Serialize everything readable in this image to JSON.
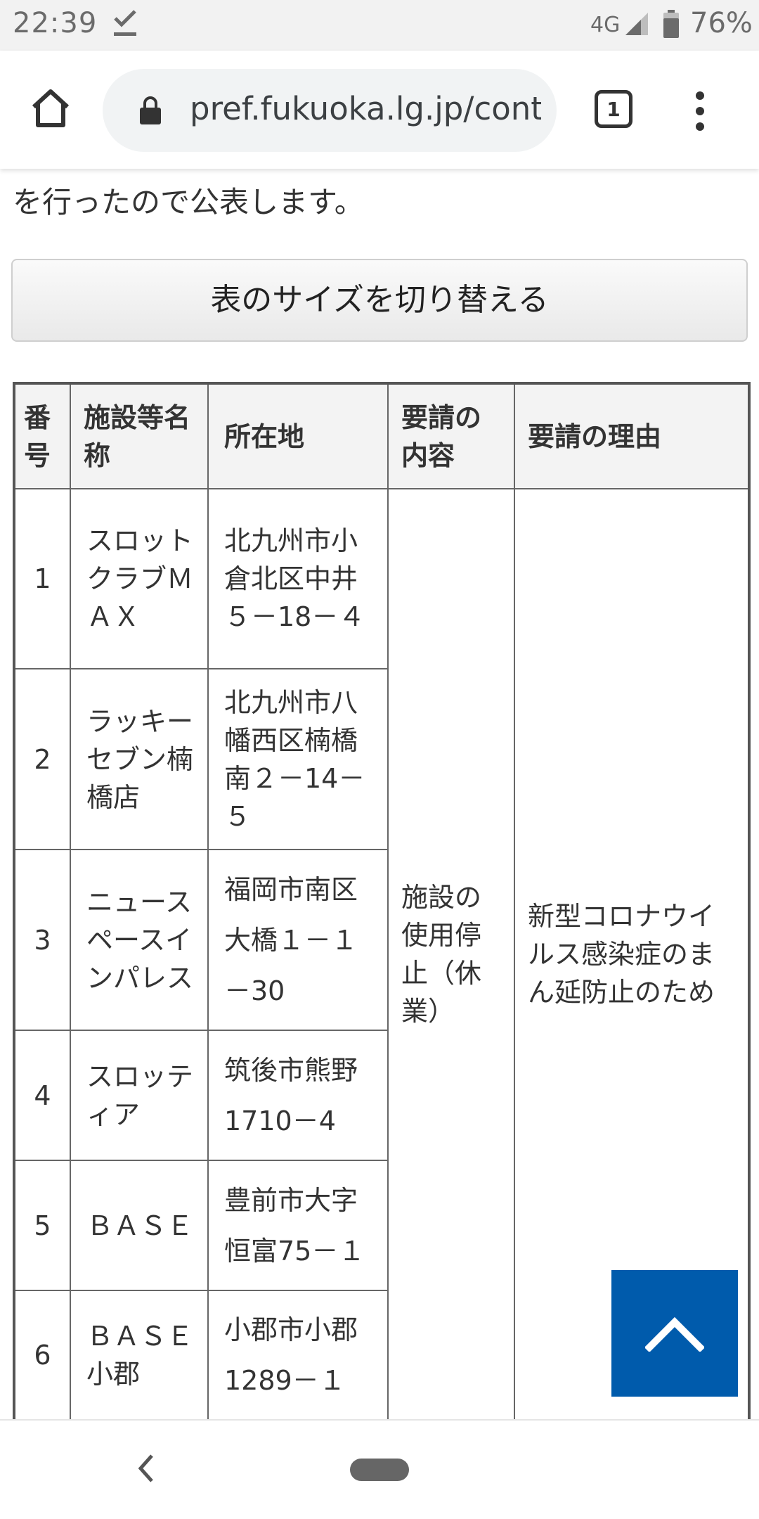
{
  "status_bar": {
    "time": "22:39",
    "network": "4G",
    "battery": "76%",
    "icons": [
      "download-done-icon",
      "signal-icon",
      "battery-icon"
    ]
  },
  "browser": {
    "url": "pref.fukuoka.lg.jp/conte",
    "tab_count": "1",
    "icons": [
      "home-icon",
      "lock-icon",
      "tabs-icon",
      "more-vert-icon"
    ]
  },
  "content": {
    "intro_text": "を行ったので公表します。",
    "toggle_button": "表のサイズを切り替える"
  },
  "table": {
    "headers": [
      "番号",
      "施設等名称",
      "所在地",
      "要請の内容",
      "要請の理由"
    ],
    "rows": [
      {
        "no": "1",
        "name": "スロットクラブＭＡＸ",
        "address": "北九州市小倉北区中井５－18－４"
      },
      {
        "no": "2",
        "name": "ラッキーセブン楠橋店",
        "address": "北九州市八幡西区楠橋南２－14－５"
      },
      {
        "no": "3",
        "name": "ニュースペースインパレス",
        "address": "福岡市南区大橋１－１－30"
      },
      {
        "no": "4",
        "name": "スロッティア",
        "address": "筑後市熊野1710－4"
      },
      {
        "no": "5",
        "name": "ＢＡＳＥ",
        "address": "豊前市大字恒富75－１"
      },
      {
        "no": "6",
        "name": "ＢＡＳＥ小郡",
        "address": "小郡市小郡1289－１"
      }
    ],
    "request_content": "施設の使用停止（休業）",
    "request_reason": "新型コロナウイルス感染症のまん延防止のため"
  },
  "colors": {
    "scroll_top_bg": "#005bac",
    "status_bar_bg": "#f2f2f2",
    "url_bar_bg": "#f1f3f4"
  },
  "scroll_top_icon": "chevron-up-icon",
  "nav_icons": [
    "back-icon",
    "home-pill"
  ]
}
